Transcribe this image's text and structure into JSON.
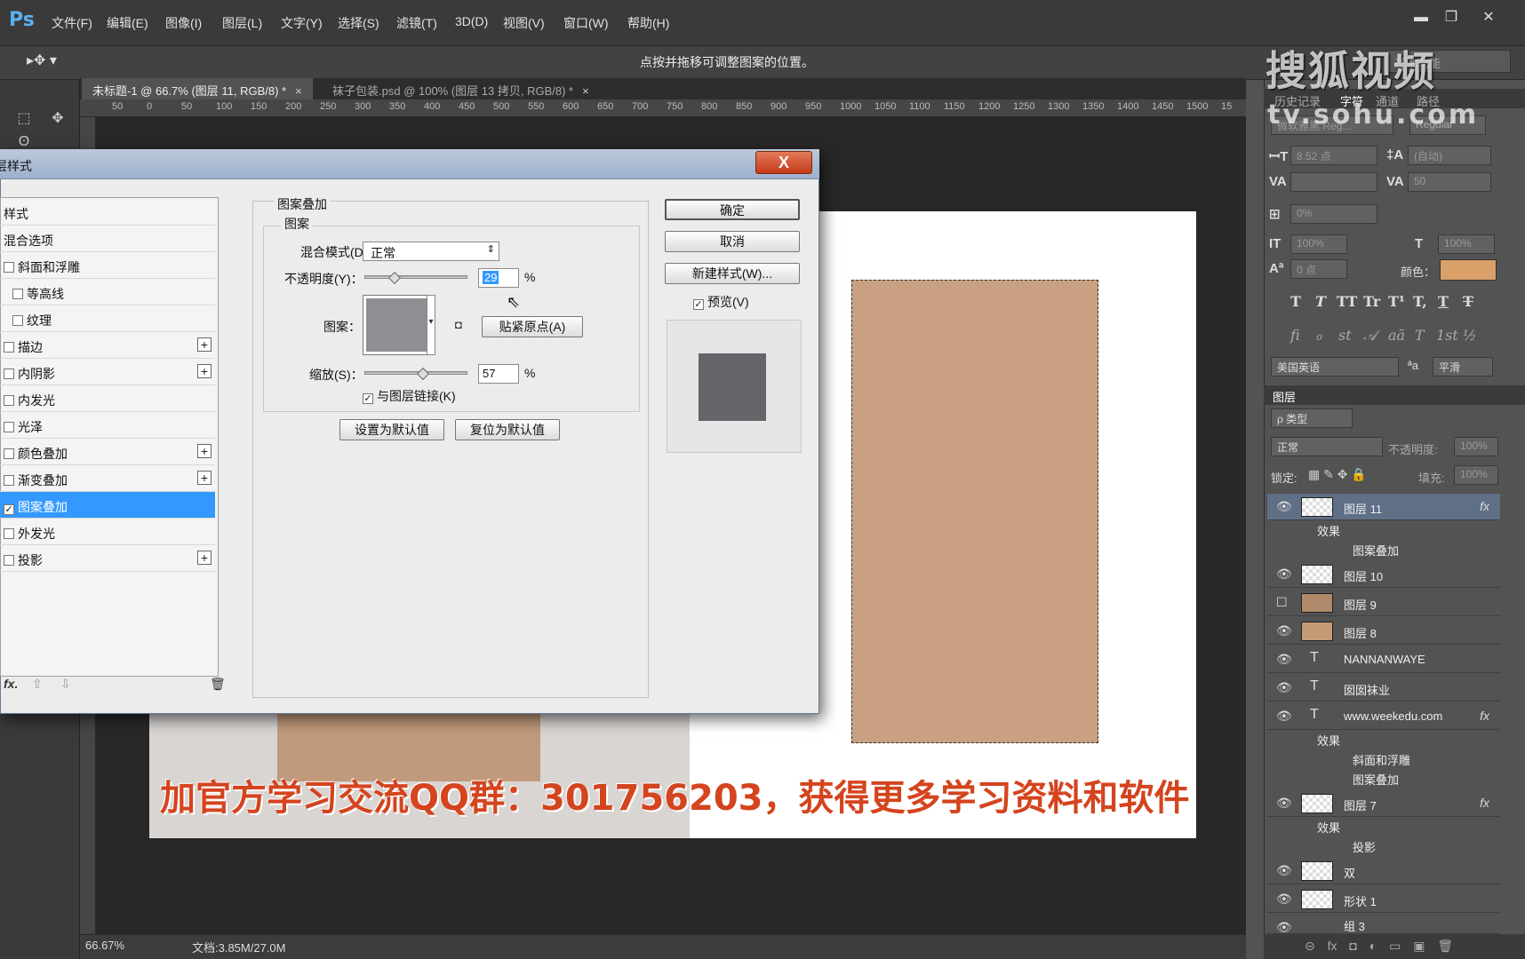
{
  "app": {
    "logo": "Ps"
  },
  "menu": [
    "文件(F)",
    "编辑(E)",
    "图像(I)",
    "图层(L)",
    "文字(Y)",
    "选择(S)",
    "滤镜(T)",
    "3D(D)",
    "视图(V)",
    "窗口(W)",
    "帮助(H)"
  ],
  "window_buttons": {
    "min": "▬",
    "max": "❐",
    "close": "✕"
  },
  "options": {
    "hint": "点按并拖移可调整图案的位置。",
    "workspace": "基本功能"
  },
  "doc_tabs": [
    {
      "label": "未标题-1 @ 66.7% (图层 11, RGB/8) *",
      "close": "×"
    },
    {
      "label": "袜子包装.psd @ 100% (图层 13 拷贝, RGB/8) *",
      "close": "×"
    }
  ],
  "ruler_ticks": [
    "50",
    "0",
    "50",
    "100",
    "150",
    "200",
    "250",
    "300",
    "350",
    "400",
    "450",
    "500",
    "550",
    "600",
    "650",
    "700",
    "750",
    "800",
    "850",
    "900",
    "950",
    "1000",
    "1050",
    "1100",
    "1150",
    "1200",
    "1250",
    "1300",
    "1350",
    "1400",
    "1450",
    "1500",
    "15"
  ],
  "canvas": {
    "box_text": "· · · · · · · · · · · · · · · ·",
    "overlay_text": "加官方学习交流QQ群：301756203，获得更多学习资料和软件"
  },
  "status": {
    "zoom": "66.67%",
    "doc": "文档:3.85M/27.0M"
  },
  "watermark": {
    "line1": "搜狐视频",
    "line2": "tv.sohu.com"
  },
  "right_panel": {
    "tabs": [
      "历史记录",
      "字符",
      "通道",
      "路径"
    ],
    "font_family": "微软雅黑 Reg...",
    "font_style": "Regular",
    "font_size": "8.52 点",
    "leading": "(自动)",
    "kerning": "",
    "tracking": "50",
    "tsume": "0%",
    "vscale": "100%",
    "hscale": "100%",
    "baseline": "0 点",
    "color_label": "颜色：",
    "text_style_glyphs": [
      "T",
      "T",
      "TT",
      "Tr",
      "T¹",
      "T,",
      "T",
      "T"
    ],
    "ligature_glyphs": [
      "ﬁ",
      "ℴ",
      "st",
      "𝒜",
      "aā",
      "T",
      "1st",
      "½"
    ],
    "language": "美国英语",
    "aa_label": "ªa",
    "antialias": "平滑"
  },
  "layers_panel": {
    "title": "图层",
    "filter": "ρ 类型",
    "blend": "正常",
    "opacity_label": "不透明度:",
    "opacity": "100%",
    "lock_label": "锁定:",
    "fill_label": "填充:",
    "fill": "100%",
    "rows": [
      {
        "name": "图层 11",
        "fx": "fx",
        "selected": true
      },
      {
        "name": "效果",
        "sub": true
      },
      {
        "name": "图案叠加",
        "sub": true
      },
      {
        "name": "图层 10"
      },
      {
        "name": "图层 9"
      },
      {
        "name": "图层 8"
      },
      {
        "name": "NANNANWAYE",
        "text": true
      },
      {
        "name": "囡囡袜业",
        "text": true
      },
      {
        "name": "www.weekedu.com",
        "text": true,
        "fx": "fx"
      },
      {
        "name": "效果",
        "sub": true
      },
      {
        "name": "斜面和浮雕",
        "sub": true
      },
      {
        "name": "图案叠加",
        "sub": true
      },
      {
        "name": "图层 7",
        "fx": "fx"
      },
      {
        "name": "效果",
        "sub": true
      },
      {
        "name": "投影",
        "sub": true
      },
      {
        "name": "双"
      },
      {
        "name": "形状 1"
      },
      {
        "name": "组 3"
      }
    ]
  },
  "dialog": {
    "title": "图层样式",
    "close": "X",
    "styles": [
      {
        "label": "样式",
        "checkbox": false
      },
      {
        "label": "混合选项",
        "checkbox": false
      },
      {
        "label": "斜面和浮雕",
        "checkbox": true,
        "checked": false
      },
      {
        "label": "等高线",
        "checkbox": true,
        "checked": false,
        "indent": true
      },
      {
        "label": "纹理",
        "checkbox": true,
        "checked": false,
        "indent": true
      },
      {
        "label": "描边",
        "checkbox": true,
        "checked": false,
        "plus": true
      },
      {
        "label": "内阴影",
        "checkbox": true,
        "checked": false,
        "plus": true
      },
      {
        "label": "内发光",
        "checkbox": true,
        "checked": false
      },
      {
        "label": "光泽",
        "checkbox": true,
        "checked": false
      },
      {
        "label": "颜色叠加",
        "checkbox": true,
        "checked": false,
        "plus": true
      },
      {
        "label": "渐变叠加",
        "checkbox": true,
        "checked": false,
        "plus": true
      },
      {
        "label": "图案叠加",
        "checkbox": true,
        "checked": true,
        "selected": true
      },
      {
        "label": "外发光",
        "checkbox": true,
        "checked": false
      },
      {
        "label": "投影",
        "checkbox": true,
        "checked": false,
        "plus": true
      }
    ],
    "footer": {
      "fx": "fx.",
      "up": "⇧",
      "down": "⇩",
      "trash": "🗑"
    },
    "section": "图案叠加",
    "group": "图案",
    "blend_label": "混合模式(D)：",
    "blend_value": "正常",
    "opacity_label": "不透明度(Y)：",
    "opacity_value": "29",
    "opacity_fraction": 0.29,
    "pattern_label": "图案：",
    "snap_button": "贴紧原点(A)",
    "scale_label": "缩放(S)：",
    "scale_value": "57",
    "scale_fraction": 0.57,
    "percent": "%",
    "link_label": "与图层链接(K)",
    "link_checked": true,
    "make_default": "设置为默认值",
    "reset_default": "复位为默认值",
    "ok": "确定",
    "cancel": "取消",
    "new_style": "新建样式(W)...",
    "preview_label": "预览(V)",
    "preview_checked": true
  }
}
